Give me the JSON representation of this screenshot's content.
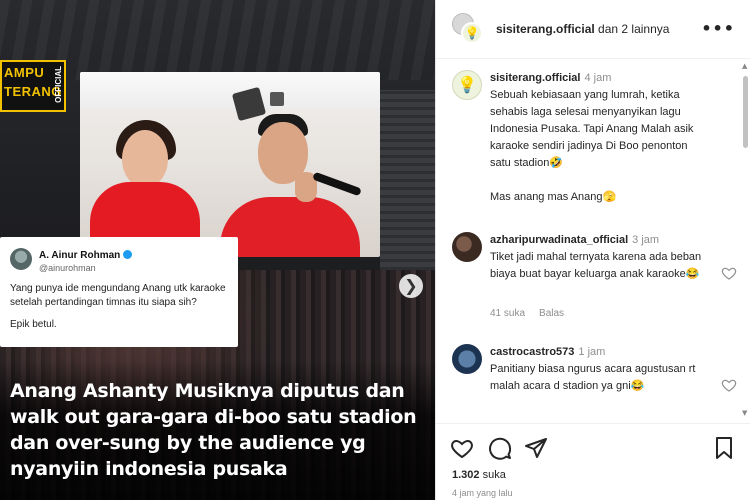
{
  "media": {
    "logo": {
      "line1": "AMPU",
      "line2": "TERANG",
      "line3": "OFFICIAL"
    },
    "tweet": {
      "name": "A. Ainur Rohman",
      "handle": "@ainurohman",
      "body": "Yang punya ide mengundang Anang utk karaoke setelah pertandingan timnas itu siapa sih?",
      "body2": "Epik betul."
    },
    "next_glyph": "❯",
    "headline": "Anang Ashanty Musiknya diputus dan walk out gara-gara di-boo satu stadion dan over-sung by the audience yg nyanyiin indonesia pusaka"
  },
  "header": {
    "username": "sisiterang.official",
    "suffix": " dan 2 lainnya",
    "more_glyph": "•••"
  },
  "comments": [
    {
      "user": "sisiterang.official",
      "time": "4 jam",
      "text": "Sebuah kebiasaan yang lumrah, ketika sehabis laga selesai menyanyikan lagu Indonesia Pusaka. Tapi Anang Malah asik karaoke sendiri jadinya Di Boo penonton satu stadion🤣",
      "text2": "Mas anang mas Anang🫣",
      "avatar_glyph": "💡"
    },
    {
      "user": "azharipurwadinata_official",
      "time": "3 jam",
      "text": "Tiket jadi mahal ternyata karena ada beban biaya buat bayar keluarga anak karaoke😂",
      "likes": "41 suka",
      "reply": "Balas"
    },
    {
      "user": "castrocastro573",
      "time": "1 jam",
      "text": "Panitiany biasa ngurus acara agustusan rt malah acara d stadion ya gni😂"
    }
  ],
  "actions": {
    "likes_count": "1.302",
    "likes_label": " suka",
    "ago": "4 jam yang lalu"
  },
  "colors": {
    "text": "#262626",
    "muted": "#8e8e8e",
    "logo_yellow": "#f2c200",
    "shirt_red": "#e41b23",
    "verified": "#1d9bf0"
  }
}
